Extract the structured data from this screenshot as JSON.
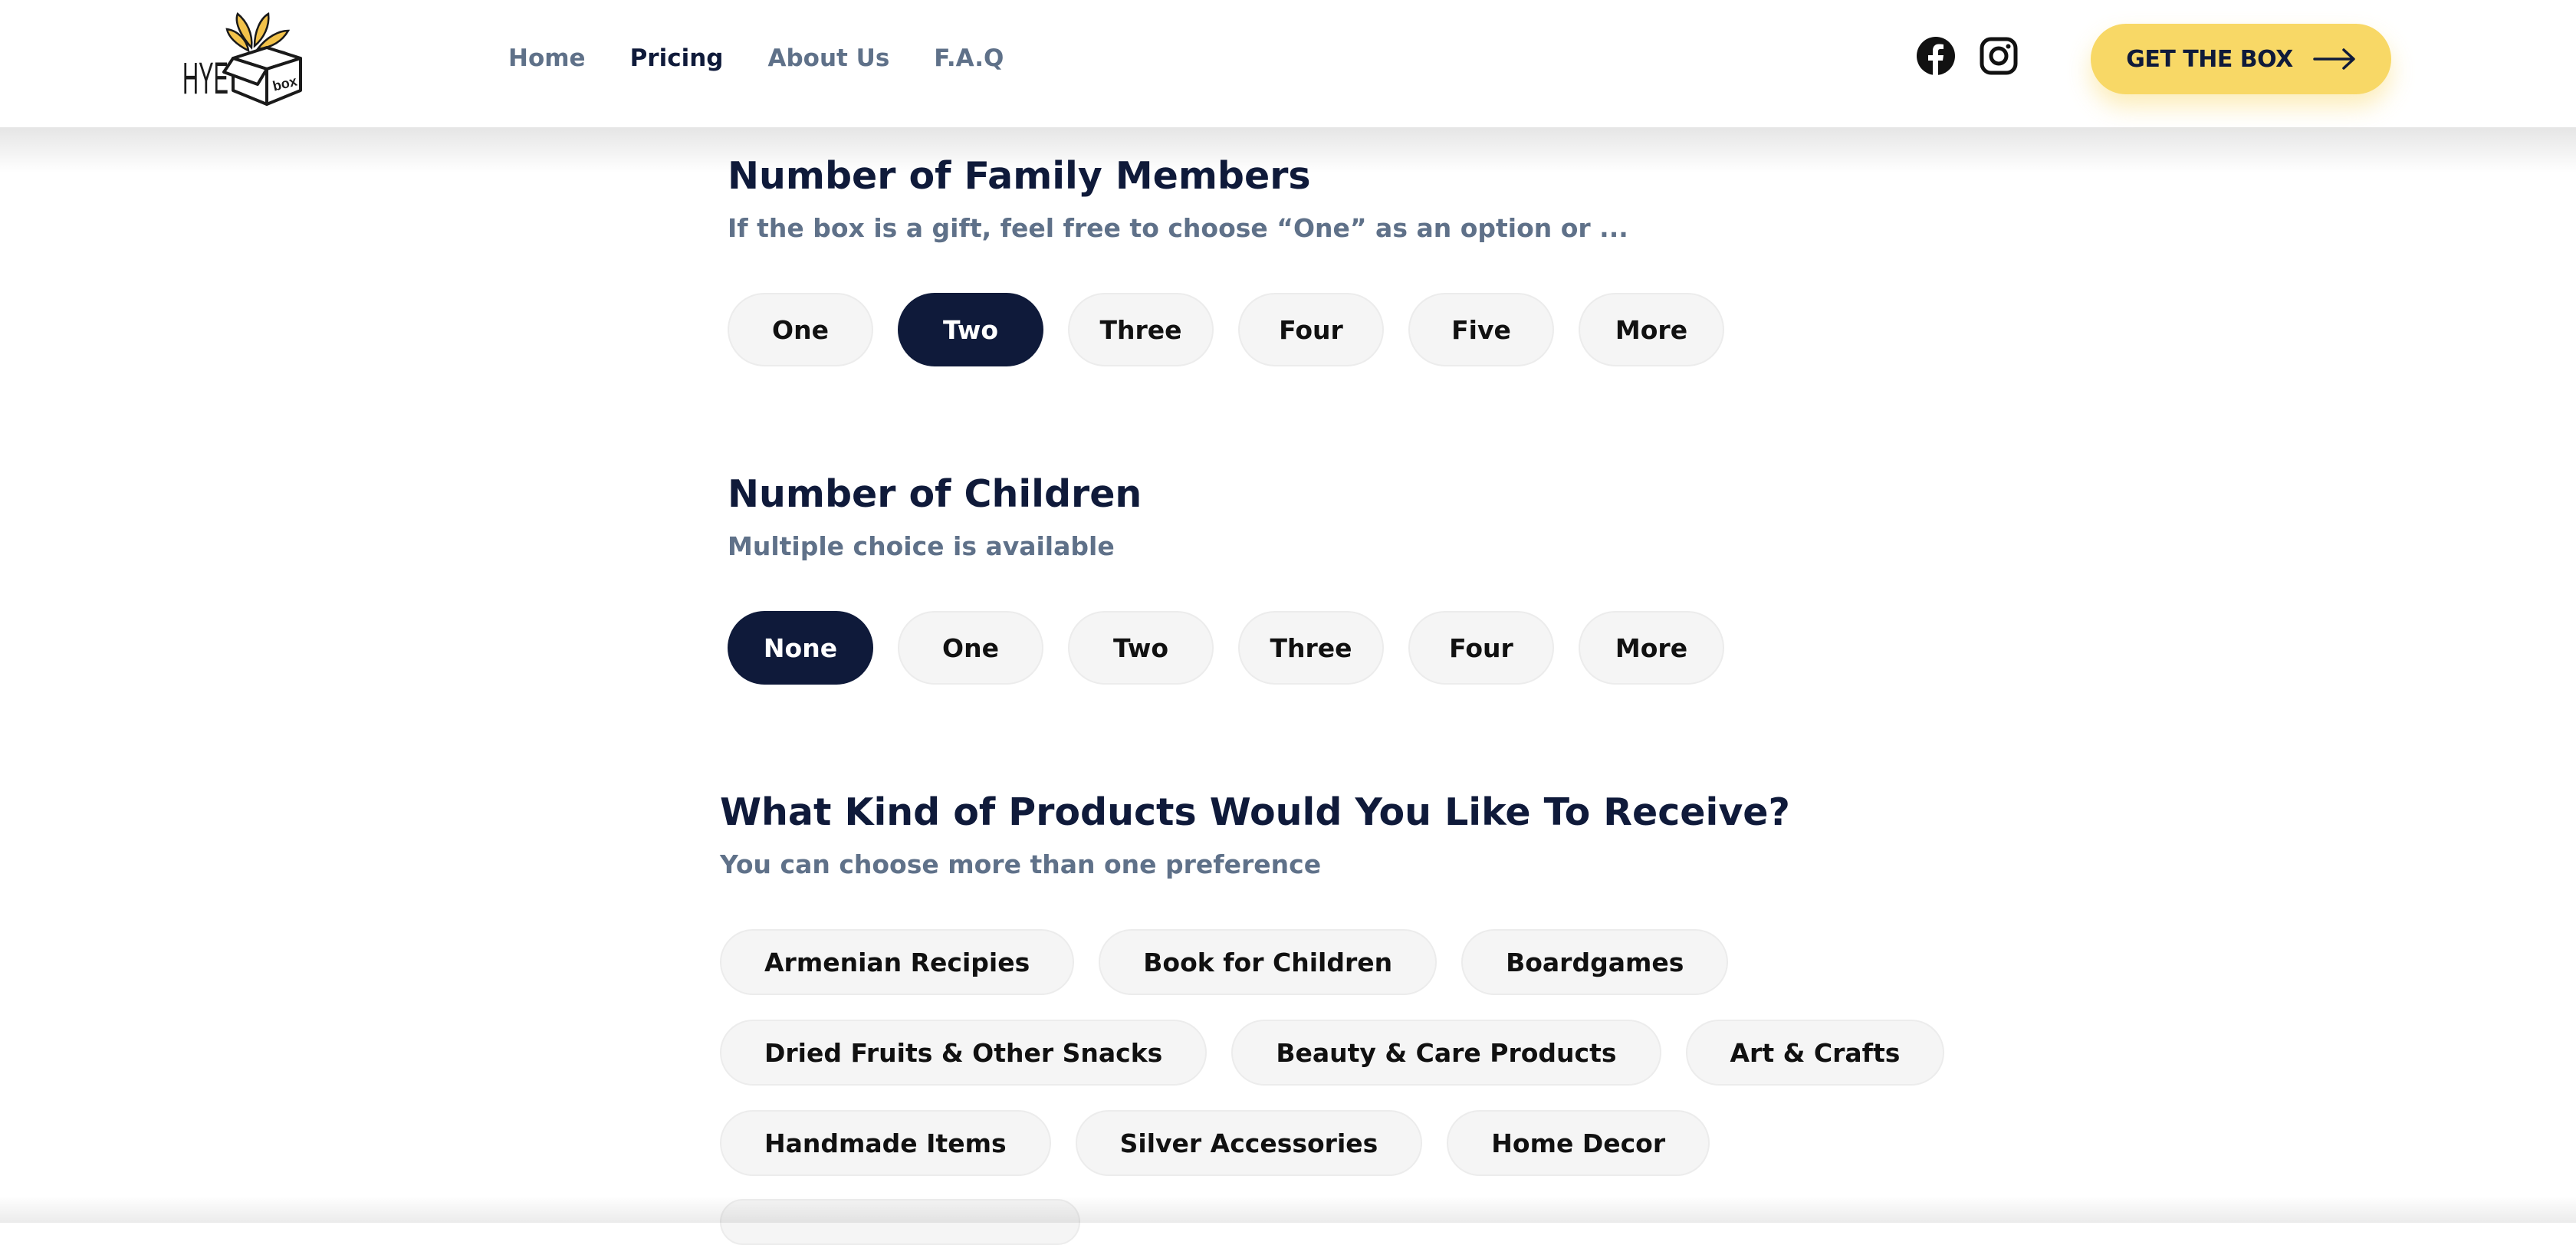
{
  "brand": {
    "logo_text": "HYE",
    "logo_box_text": "box"
  },
  "nav": {
    "items": [
      {
        "label": "Home",
        "active": false
      },
      {
        "label": "Pricing",
        "active": true
      },
      {
        "label": "About Us",
        "active": false
      },
      {
        "label": "F.A.Q",
        "active": false
      }
    ]
  },
  "social": {
    "icons": [
      "facebook-icon",
      "instagram-icon"
    ]
  },
  "cta": {
    "label": "GET THE BOX",
    "icon": "arrow-right-icon"
  },
  "family": {
    "title": "Number of Family Members",
    "subtitle": "If the box is a gift, feel free to choose “One” as an option or ...",
    "options": [
      "One",
      "Two",
      "Three",
      "Four",
      "Five",
      "More"
    ],
    "selected": "Two"
  },
  "children": {
    "title": "Number of Children",
    "subtitle": "Multiple choice is available",
    "options": [
      "None",
      "One",
      "Two",
      "Three",
      "Four",
      "More"
    ],
    "selected": "None"
  },
  "products": {
    "title": "What Kind of Products Would You Like To Receive?",
    "subtitle": "You can choose more than one preference",
    "rows": [
      [
        "Armenian Recipies",
        "Book for Children",
        "Boardgames"
      ],
      [
        "Dried Fruits & Other Snacks",
        "Beauty & Care Products",
        "Art & Crafts"
      ],
      [
        "Handmade Items",
        "Silver Accessories",
        "Home Decor"
      ]
    ]
  },
  "colors": {
    "navy": "#0f1a3a",
    "muted": "#5f7189",
    "accent_yellow": "#f8d866",
    "chip_bg": "#f5f5f5"
  }
}
